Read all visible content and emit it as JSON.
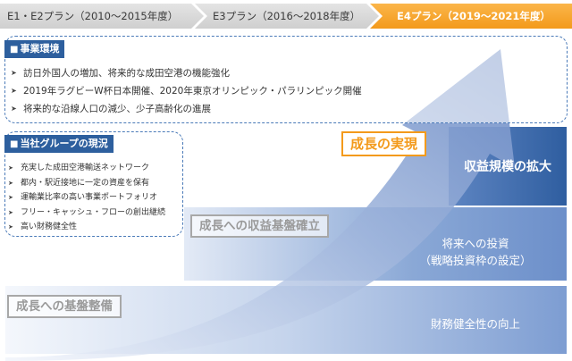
{
  "plans": [
    {
      "label": "E1・E2プラン（2010〜2015年度）"
    },
    {
      "label": "E3プラン（2016〜2018年度）"
    },
    {
      "label": "E4プラン（2019〜2021年度）"
    }
  ],
  "business_environment": {
    "heading": "事業環境",
    "items": [
      "訪日外国人の増加、将来的な成田空港の機能強化",
      "2019年ラグビーW杯日本開催、2020年東京オリンピック・パラリンピック開催",
      "将来的な沿線人口の減少、少子高齢化の進展"
    ]
  },
  "group_status": {
    "heading": "当社グループの現況",
    "items": [
      "充実した成田空港輸送ネットワーク",
      "都内・駅近接地に一定の資産を保有",
      "運輸業比率の高い事業ポートフォリオ",
      "フリー・キャッシュ・フローの創出継続",
      "高い財務健全性"
    ]
  },
  "bands": {
    "top": "収益規模の拡大",
    "mid_line1": "将来への投資",
    "mid_line2": "（戦略投資枠の設定）",
    "bottom": "財務健全性の向上"
  },
  "stages": {
    "s1": "成長への基盤整備",
    "s2": "成長への収益基盤確立",
    "s3": "成長の実現"
  },
  "colors": {
    "accent_orange": "#f39a1b",
    "deep_blue": "#2d5f9e"
  }
}
